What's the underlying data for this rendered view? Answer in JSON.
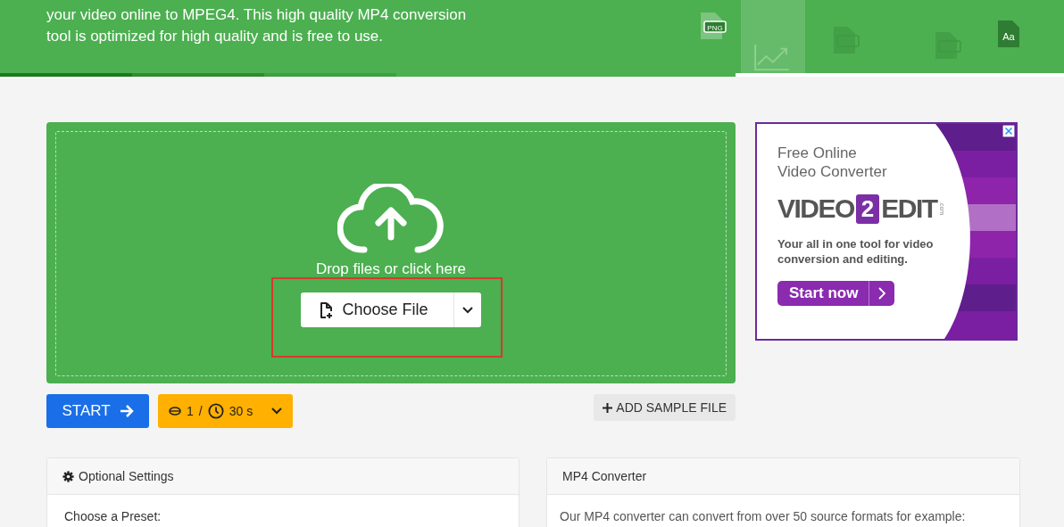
{
  "banner": {
    "description": [
      "your video online to MPEG4. This high quality MP4 conversion",
      "tool is optimized for high quality and is free to use."
    ],
    "file_icons": [
      {
        "label": "PNG"
      },
      {
        "label": "Aa"
      }
    ]
  },
  "upload": {
    "prompt": "Drop files or click here",
    "choose_button": "Choose File"
  },
  "actions": {
    "start": "START",
    "credits": "1",
    "separator": "/",
    "time": "30 s",
    "sample": "ADD SAMPLE FILE"
  },
  "ad": {
    "heading": [
      "Free Online",
      "Video Converter"
    ],
    "logo": {
      "left": "VIDEO",
      "number": "2",
      "right": "EDIT",
      "suffix": ".com"
    },
    "text": "Your all in one tool for video conversion and editing.",
    "button": "Start now"
  },
  "settings": {
    "title": "Optional Settings",
    "preset_label": "Choose a Preset:"
  },
  "info": {
    "title": "MP4 Converter",
    "text": "Our MP4 converter can convert from over 50 source formats for example:"
  }
}
